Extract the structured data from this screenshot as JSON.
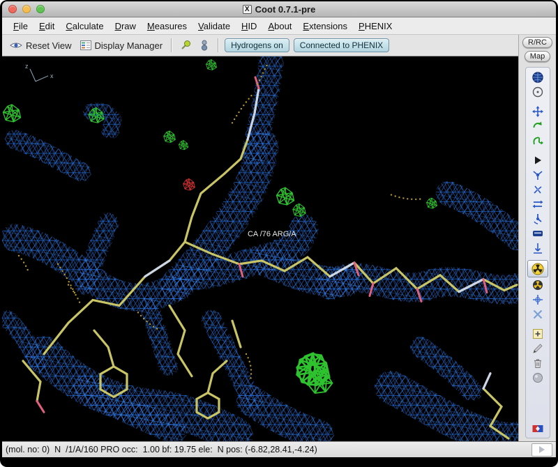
{
  "window": {
    "title": "Coot 0.7.1-pre",
    "icon_glyph": "X"
  },
  "menu": {
    "items": [
      "File",
      "Edit",
      "Calculate",
      "Draw",
      "Measures",
      "Validate",
      "HID",
      "About",
      "Extensions",
      "PHENIX"
    ]
  },
  "toolbar": {
    "reset_view_label": "Reset View",
    "display_manager_label": "Display Manager",
    "hydrogens_label": "Hydrogens on",
    "phenix_label": "Connected to PHENIX"
  },
  "right_panel": {
    "rrc_label": "R/RC",
    "map_label": "Map",
    "tools": [
      "globe-icon",
      "recentre-icon",
      "translate-icon",
      "rotate-icon",
      "torsion-icon",
      "play-icon",
      "atom-icon",
      "chi-angles-icon",
      "flip-icon",
      "rotamer-icon",
      "side-chain-icon",
      "axes-icon",
      "radiation-selected-icon",
      "radiation-icon",
      "map-cross-icon",
      "clear-icon",
      "add-atom-icon",
      "pencil-icon",
      "delete-icon",
      "sphere-icon",
      "display-flag-icon"
    ]
  },
  "canvas": {
    "residue_label": "CA /76 ARG/A",
    "axes": {
      "x": "x",
      "z": "z"
    }
  },
  "statusbar": {
    "text": "(mol. no: 0)  N  /1/A/160 PRO occ:  1.00 bf: 19.75 ele:  N pos: (-6.82,28.41,-4.24)"
  },
  "colors": {
    "mesh_blue": "#1E62C8",
    "mesh_blue_light": "#3E86F0",
    "model_yellow": "#C9C566",
    "model_light": "#CCD6E6",
    "oxygen_pink": "#E0607E",
    "diff_green": "#2EC22E",
    "diff_red": "#D03030",
    "dots_yellow": "#B89B2F",
    "toggle_teal": "#CDE7EE"
  }
}
